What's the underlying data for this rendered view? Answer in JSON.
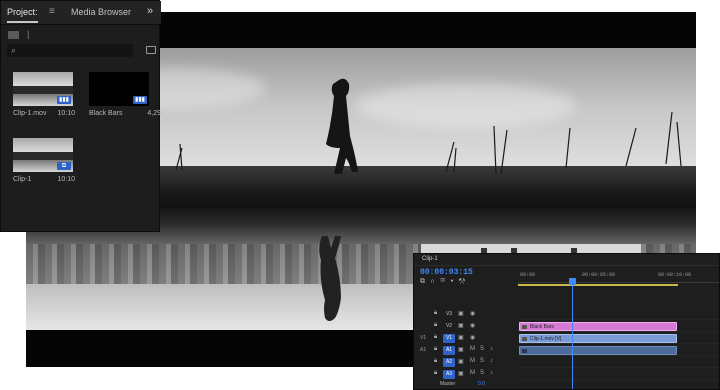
{
  "project_panel": {
    "tab_project": "Project:",
    "tab_media": "Media Browser",
    "path_separator": "|",
    "search_placeholder": "",
    "items": [
      {
        "name": "Clip-1.mov",
        "duration": "10:10",
        "badge": "▮▮▮"
      },
      {
        "name": "Black Bars",
        "duration": "4,29",
        "badge": "▮▮▮"
      },
      {
        "name": "Clip-1",
        "duration": "10:10",
        "badge": "⧉"
      }
    ]
  },
  "timeline": {
    "tab_label": "Clip-1",
    "timecode": "00:00:03:15",
    "ruler_labels": [
      "00:00",
      "00:00:05:00",
      "00:00:10:00"
    ],
    "tracks": [
      {
        "name": "V3",
        "target": "",
        "active": false
      },
      {
        "name": "V2",
        "target": "",
        "active": false
      },
      {
        "name": "V1",
        "target": "V1",
        "active": true
      },
      {
        "name": "A1",
        "target": "A1",
        "active": true
      },
      {
        "name": "A2",
        "target": "",
        "active": true
      },
      {
        "name": "A3",
        "target": "",
        "active": true
      }
    ],
    "audio_ctrls": [
      "M",
      "S"
    ],
    "clips": {
      "black_bars": "Black Bars",
      "video": "Clip-1.mov [V]"
    },
    "master_label": "Master",
    "master_value": "0.0"
  }
}
